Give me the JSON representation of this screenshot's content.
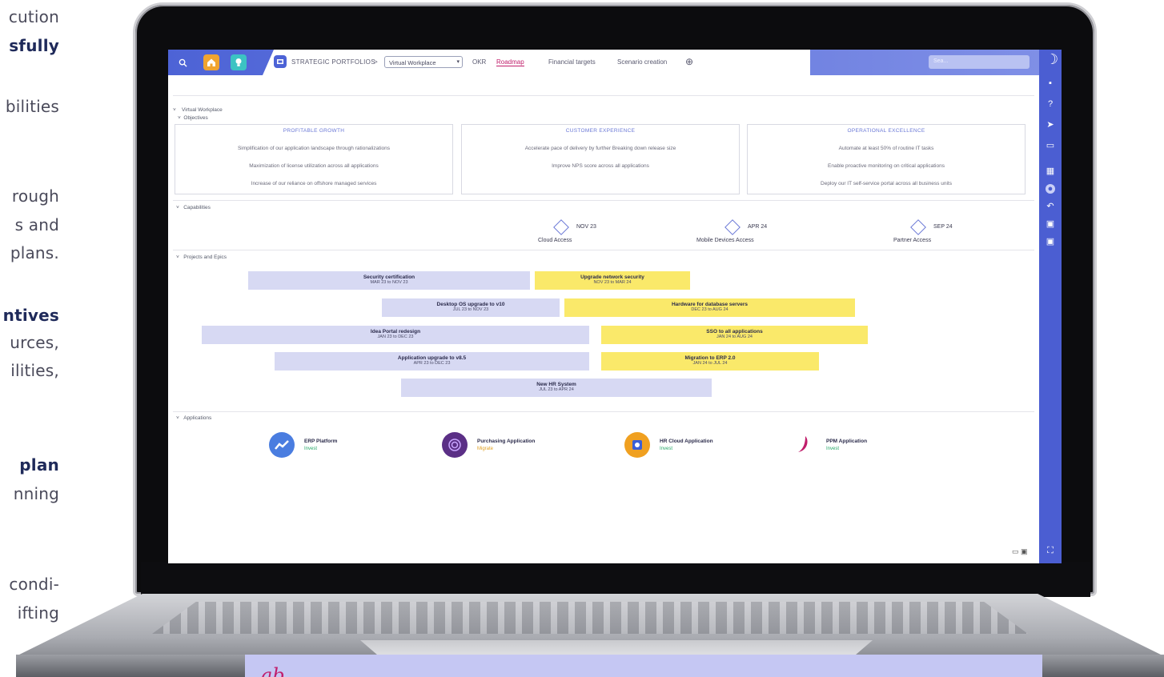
{
  "side_text": [
    {
      "text": "cution",
      "bold": false
    },
    {
      "text": "sfully",
      "bold": true
    },
    {
      "text": "bilities",
      "bold": false
    },
    {
      "text": "rough",
      "bold": false
    },
    {
      "text": "s and",
      "bold": false
    },
    {
      "text": "plans.",
      "bold": false
    },
    {
      "text": "ntives",
      "bold": true
    },
    {
      "text": "urces,",
      "bold": false
    },
    {
      "text": "ilities,",
      "bold": false
    },
    {
      "text": "plan",
      "bold": true
    },
    {
      "text": "nning",
      "bold": false
    },
    {
      "text": "condi-",
      "bold": false
    },
    {
      "text": "ifting",
      "bold": false
    }
  ],
  "bottom_mark": "ab",
  "topbar": {
    "breadcrumb_root": "STRATEGIC PORTFOLIOS",
    "breadcrumb_sep": ">",
    "workspace_select": "Virtual Workplace",
    "tabs": [
      "OKR",
      "Roadmap",
      "Financial targets",
      "Scenario creation"
    ],
    "active_tab": "Roadmap",
    "search_placeholder": "Sea..."
  },
  "tree": {
    "root": "Virtual Workplace",
    "objectives": "Objectives",
    "capabilities": "Capabilities",
    "projects": "Projects and Epics",
    "applications": "Applications"
  },
  "objectives": [
    {
      "title": "PROFITABLE GROWTH",
      "items": [
        "Simplification of our application landscape through rationalizations",
        "Maximization of license utilization across all applications",
        "Increase of our reliance on offshore managed services"
      ]
    },
    {
      "title": "CUSTOMER EXPERIENCE",
      "items": [
        "Accelerate pace of delivery by further Breaking down release size",
        "Improve NPS score across all applications"
      ]
    },
    {
      "title": "OPERATIONAL EXCELLENCE",
      "items": [
        "Automate at least 50% of routine IT tasks",
        "Enable proactive monitoring on critical applications",
        "Deploy our IT self-service portal across all business units"
      ]
    }
  ],
  "capabilities": [
    {
      "date": "NOV 23",
      "name": "Cloud Access"
    },
    {
      "date": "APR 24",
      "name": "Mobile Devices Access"
    },
    {
      "date": "SEP 24",
      "name": "Partner Access"
    }
  ],
  "projects": [
    {
      "title": "Security certification",
      "dates": "MAR 23 to NOV 23",
      "color": "lav"
    },
    {
      "title": "Upgrade network security",
      "dates": "NOV 23 to MAR 24",
      "color": "yel"
    },
    {
      "title": "Desktop OS upgrade to v10",
      "dates": "JUL 23 to NOV 23",
      "color": "lav"
    },
    {
      "title": "Hardware for database servers",
      "dates": "DEC 23 to AUG 24",
      "color": "yel"
    },
    {
      "title": "Idea Portal redesign",
      "dates": "JAN 23 to DEC 23",
      "color": "lav"
    },
    {
      "title": "SSO to all applications",
      "dates": "JAN 24 to AUG 24",
      "color": "yel"
    },
    {
      "title": "Application upgrade to v8.5",
      "dates": "APR 23 to DEC 23",
      "color": "lav"
    },
    {
      "title": "Migration to ERP 2.0",
      "dates": "JAN 24 to JUL 24",
      "color": "yel"
    },
    {
      "title": "New HR System",
      "dates": "JUL 23 to APR 24",
      "color": "lav"
    }
  ],
  "applications": [
    {
      "name": "ERP Platform",
      "status": "Invest",
      "status_color": "#28a86a",
      "icon_color": "#4a7de0",
      "icon": "erp-icon"
    },
    {
      "name": "Purchasing Application",
      "status": "Migrate",
      "status_color": "#e0a020",
      "icon_color": "#5b2f86",
      "icon": "purchasing-icon"
    },
    {
      "name": "HR Cloud Application",
      "status": "Invest",
      "status_color": "#28a86a",
      "icon_color": "#f0a020",
      "icon": "hr-cloud-icon"
    },
    {
      "name": "PPM Application",
      "status": "Invest",
      "status_color": "#28a86a",
      "icon_color": "#c01e6b",
      "icon": "ppm-icon"
    }
  ],
  "colors": {
    "accent": "#4d63d6",
    "active_tab": "#c01e6b",
    "bar_lav": "#d7d9f3",
    "bar_yel": "#fae96a"
  }
}
